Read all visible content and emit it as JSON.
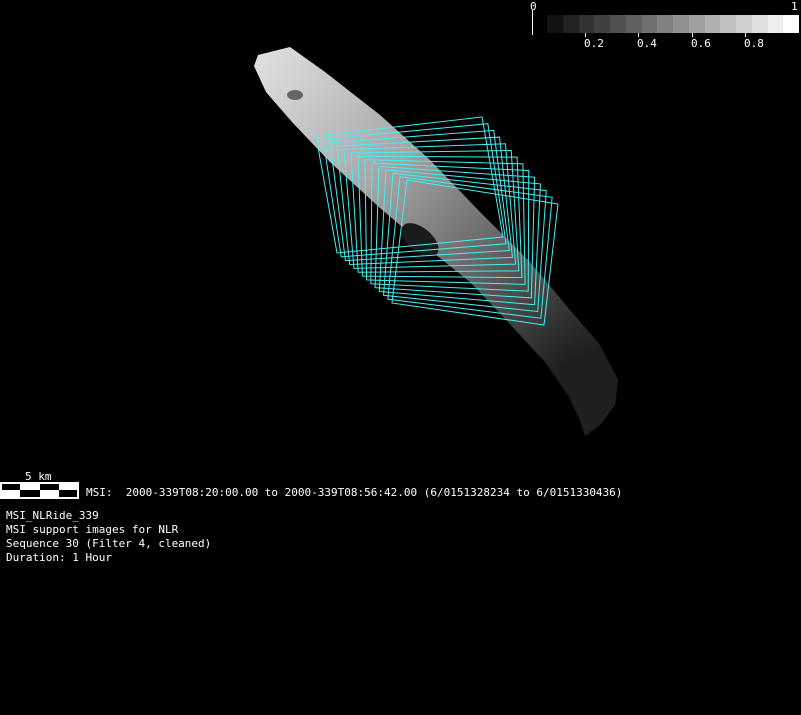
{
  "colorbar": {
    "min_label": "0",
    "max_label": "1",
    "tick_labels": [
      "0.2",
      "0.4",
      "0.6",
      "0.8"
    ],
    "steps": 16
  },
  "scale_bar": {
    "label": "5 km"
  },
  "time_range": "MSI:  2000-339T08:20:00.00 to 2000-339T08:56:42.00 (6/0151328234 to 6/0151330436)",
  "info_lines": [
    "MSI_NLRide_339",
    "MSI support images for NLR",
    "Sequence 30 (Filter 4, cleaned)",
    "Duration: 1 Hour"
  ],
  "footprints": {
    "count": 14,
    "color": "#44f0f0"
  }
}
